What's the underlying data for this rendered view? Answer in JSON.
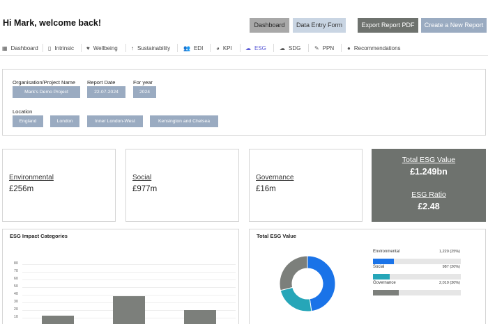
{
  "header": {
    "greeting": "Hi Mark, welcome back!",
    "buttons": {
      "dashboard": "Dashboard",
      "data_entry": "Data Entry Form",
      "export_pdf": "Export Report PDF",
      "create_report": "Create a New Report"
    }
  },
  "tabs": [
    {
      "label": "Dashboard",
      "icon": "grid-icon"
    },
    {
      "label": "Intrinsic",
      "icon": "document-icon"
    },
    {
      "label": "Wellbeing",
      "icon": "heart-icon"
    },
    {
      "label": "Sustainability",
      "icon": "arrow-up-icon"
    },
    {
      "label": "EDI",
      "icon": "users-icon"
    },
    {
      "label": "KPI",
      "icon": "pie-icon"
    },
    {
      "label": "ESG",
      "icon": "cloud-icon",
      "active": true
    },
    {
      "label": "SDG",
      "icon": "cloud-icon"
    },
    {
      "label": "PPN",
      "icon": "pen-icon"
    },
    {
      "label": "Recommendations",
      "icon": "bulb-icon"
    }
  ],
  "info": {
    "org_label": "Organisation/Project Name",
    "org_value": "Mark's Demo Project",
    "date_label": "Report Date",
    "date_value": "22-07-2024",
    "year_label": "For year",
    "year_value": "2024",
    "location_label": "Location",
    "locations": [
      "England",
      "London",
      "Inner London-West",
      "Kensington and Chelsea"
    ]
  },
  "metrics": {
    "environmental": {
      "name": "Environmental",
      "value": "£256m"
    },
    "social": {
      "name": "Social",
      "value": "£977m"
    },
    "governance": {
      "name": "Governance",
      "value": "£16m"
    }
  },
  "total": {
    "esg_value_label": "Total ESG Value",
    "esg_value": "£1.249bn",
    "esg_ratio_label": "ESG Ratio",
    "esg_ratio": "£2.48"
  },
  "colors": {
    "accent": "#5b5bd6",
    "button_grey": "#6e726e",
    "chip": "#9aabc1",
    "donut_blue": "#1a73e8",
    "donut_teal": "#26a6b8",
    "donut_grey": "#7c7f7b"
  },
  "impact_chart": {
    "title": "ESG Impact Categories",
    "chart_data": {
      "type": "bar",
      "title": "ESG Impact Categories",
      "ylim": [
        0,
        80
      ],
      "yticks": [
        10,
        20,
        30,
        40,
        50,
        60,
        70,
        80
      ],
      "categories": [
        "",
        "",
        ""
      ],
      "values": [
        13,
        38,
        20
      ]
    }
  },
  "total_chart": {
    "title": "Total ESG Value",
    "chart_data": {
      "type": "pie",
      "title": "Total ESG Value",
      "series": [
        {
          "name": "Environmental",
          "value": 1220,
          "display": "1,220 (25%)",
          "pct": 25,
          "color": "#7c7f7b"
        },
        {
          "name": "Social",
          "value": 987,
          "display": "987 (20%)",
          "pct": 20,
          "color": "#26a6b8"
        },
        {
          "name": "Governance",
          "value": 2010,
          "display": "2,010 (30%)",
          "pct": 30,
          "color": "#1a73e8"
        }
      ]
    }
  }
}
